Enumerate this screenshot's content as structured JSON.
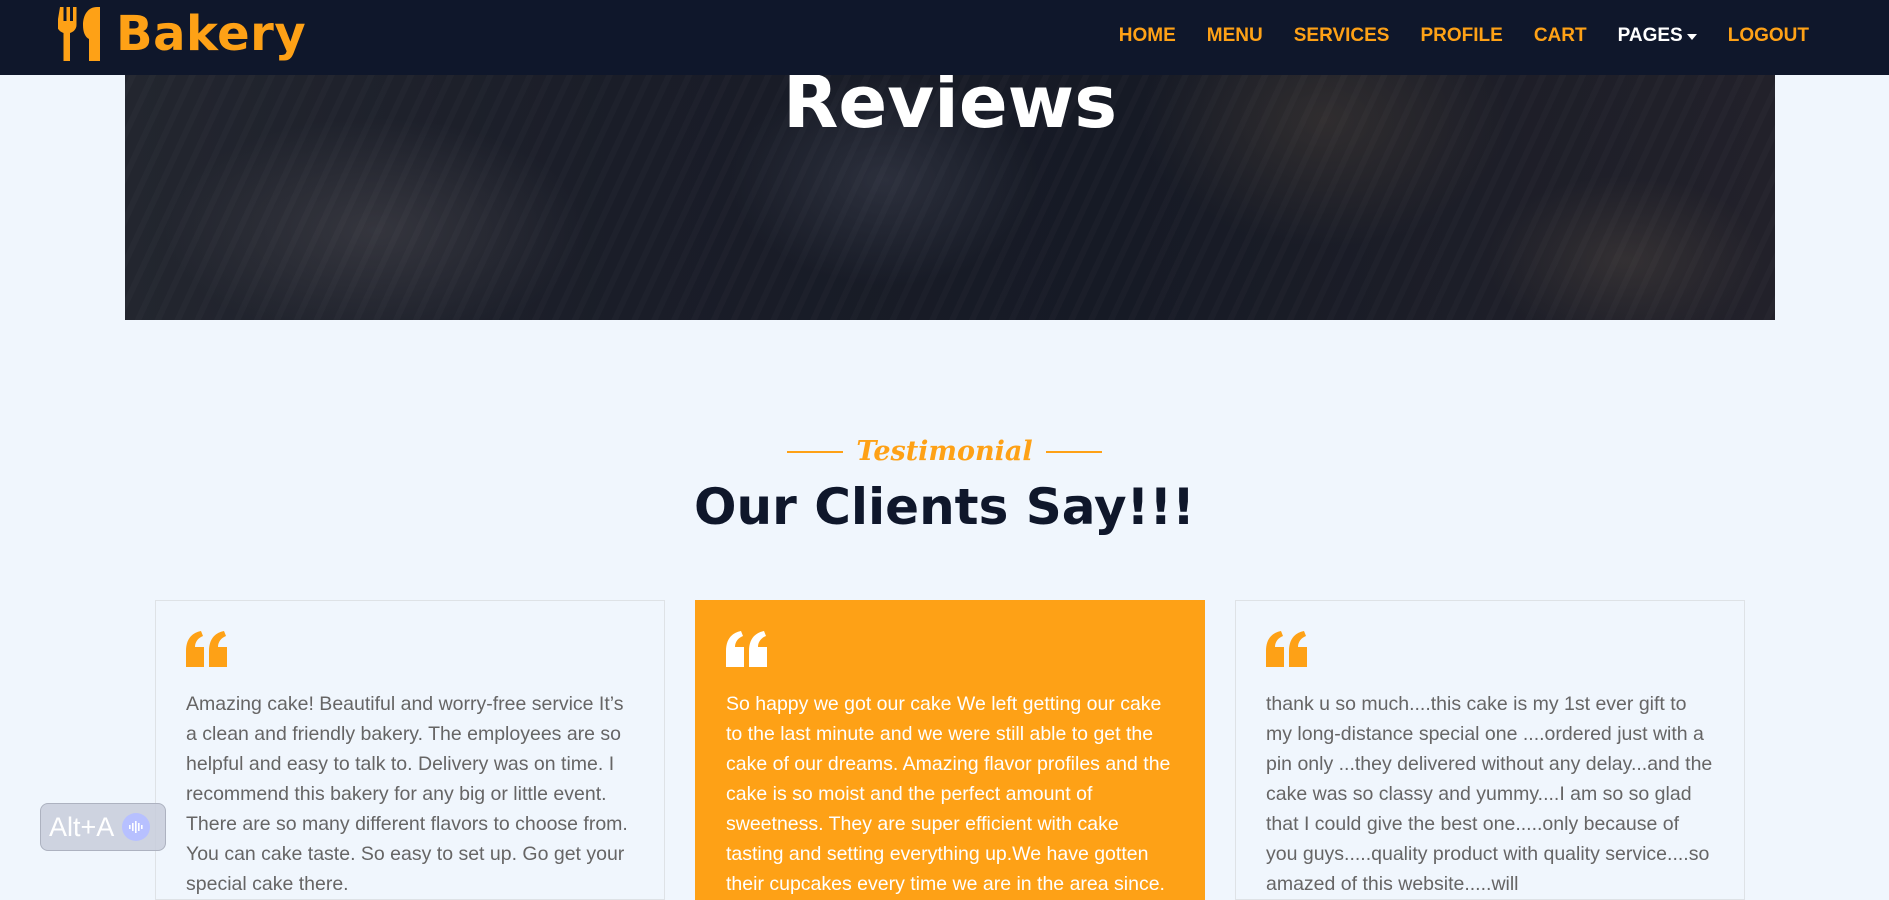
{
  "brand": {
    "name": "Bakery",
    "icon": "utensils-icon"
  },
  "nav": {
    "items": [
      {
        "label": "HOME"
      },
      {
        "label": "MENU"
      },
      {
        "label": "SERVICES"
      },
      {
        "label": "PROFILE"
      },
      {
        "label": "CART"
      },
      {
        "label": "PAGES"
      },
      {
        "label": "LOGOUT"
      }
    ],
    "active": "PAGES"
  },
  "hero": {
    "title": "Reviews"
  },
  "testimonial": {
    "label": "Testimonial",
    "title": "Our Clients Say!!!",
    "cards": [
      {
        "text": "Amazing cake! Beautiful and worry-free service It’s a clean and friendly bakery. The employees are so helpful and easy to talk to. Delivery was on time. I recommend this bakery for any big or little event. There are so many different flavors to choose from. You can cake taste. So easy to set up. Go get your special cake there.",
        "highlighted": false
      },
      {
        "text": "So happy we got our cake We left getting our cake to the last minute and we were still able to get the cake of our dreams. Amazing flavor profiles and the cake is so moist and the perfect amount of sweetness. They are super efficient with cake tasting and setting everything up.We have gotten their cupcakes every time we are in the area since.",
        "highlighted": true
      },
      {
        "text": "thank u so much....this cake is my 1st ever gift to my long-distance special one ....ordered just with a pin only ...they delivered without any delay...and the cake was so classy and yummy....I am so so glad that I could give the best one.....only because of you guys.....quality product with quality service....so amazed of this website.....will",
        "highlighted": false
      }
    ]
  },
  "widget": {
    "label": "Alt+A",
    "icon": "voice-wave-icon"
  },
  "colors": {
    "accent": "#fea116",
    "dark": "#0f172b",
    "background": "#f0f6fd",
    "text": "#666565"
  }
}
